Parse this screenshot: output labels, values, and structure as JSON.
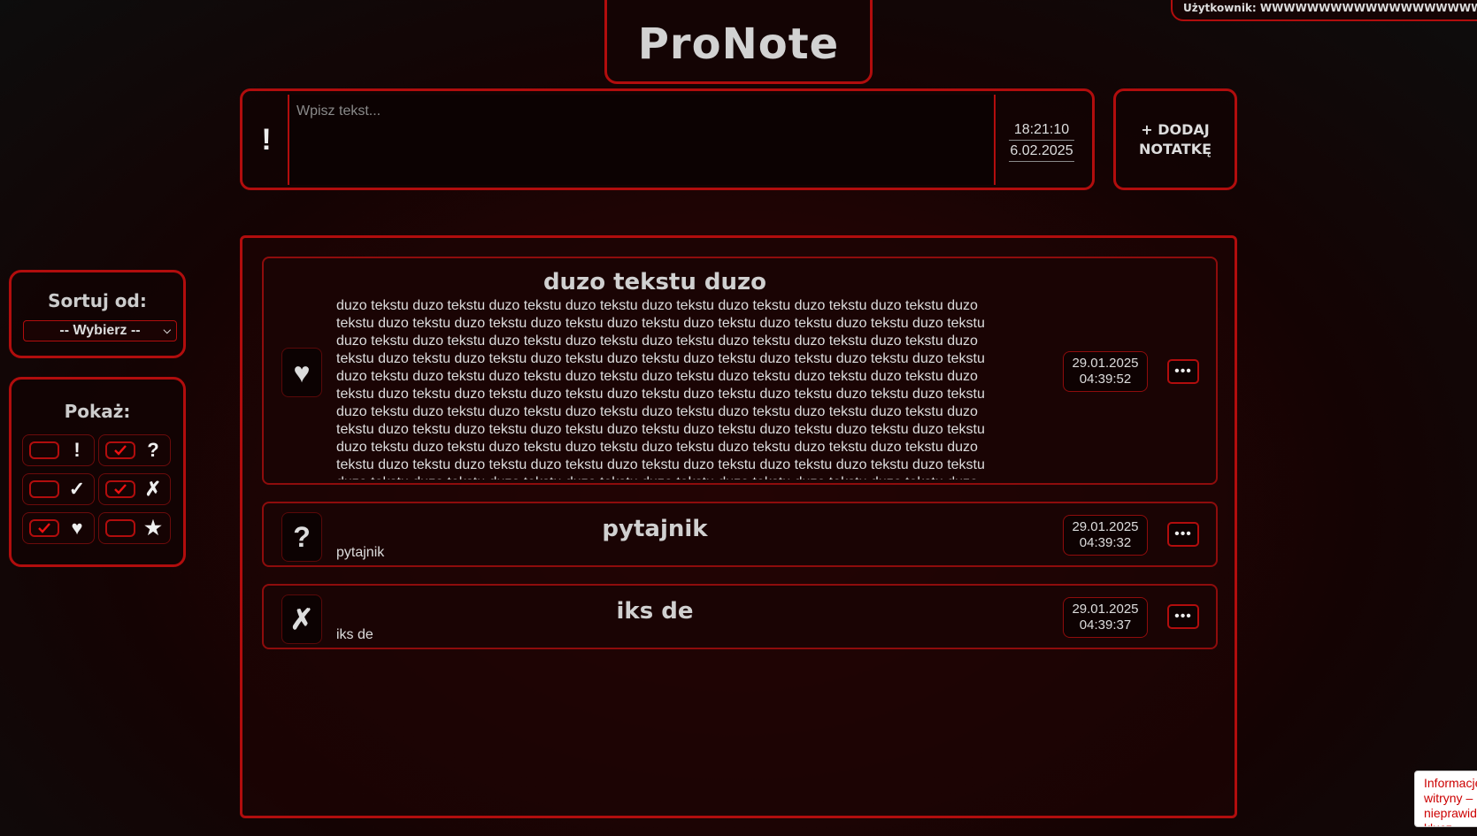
{
  "app": {
    "title": "ProNote",
    "user_label": "Użytkownik: WWWWWWWWWWWWWWWWWWWWWW"
  },
  "composer": {
    "priority_symbol": "!",
    "placeholder": "Wpisz tekst...",
    "time": "18:21:10",
    "date": "6.02.2025",
    "add_button": "+ DODAJ NOTATKĘ"
  },
  "sort": {
    "title": "Sortuj od:",
    "selected": "-- Wybierz --"
  },
  "filters": {
    "title": "Pokaż:",
    "items": [
      {
        "symbol": "!",
        "icon": "exclamation-icon",
        "checked": false
      },
      {
        "symbol": "?",
        "icon": "question-icon",
        "checked": true
      },
      {
        "symbol": "✓",
        "icon": "checkmark-icon",
        "checked": false
      },
      {
        "symbol": "✗",
        "icon": "cross-icon",
        "checked": true
      },
      {
        "symbol": "♥",
        "icon": "heart-icon",
        "checked": true
      },
      {
        "symbol": "★",
        "icon": "star-icon",
        "checked": false
      }
    ]
  },
  "notes": [
    {
      "icon": "heart-icon",
      "symbol": "♥",
      "title": "duzo tekstu duzo",
      "body": "duzo tekstu duzo tekstu duzo tekstu duzo tekstu duzo tekstu duzo tekstu duzo tekstu duzo tekstu duzo tekstu duzo tekstu duzo tekstu duzo tekstu duzo tekstu duzo tekstu duzo tekstu duzo tekstu duzo tekstu duzo tekstu duzo tekstu duzo tekstu duzo tekstu duzo tekstu duzo tekstu duzo tekstu duzo tekstu duzo tekstu duzo tekstu duzo tekstu duzo tekstu duzo tekstu duzo tekstu duzo tekstu duzo tekstu duzo tekstu duzo tekstu duzo tekstu duzo tekstu duzo tekstu duzo tekstu duzo tekstu duzo tekstu duzo tekstu duzo tekstu duzo tekstu duzo tekstu duzo tekstu duzo tekstu duzo tekstu duzo tekstu duzo tekstu duzo tekstu duzo tekstu duzo tekstu duzo tekstu duzo tekstu duzo tekstu duzo tekstu duzo tekstu duzo tekstu duzo tekstu duzo tekstu duzo tekstu duzo tekstu duzo tekstu duzo tekstu duzo tekstu duzo tekstu duzo tekstu duzo tekstu duzo tekstu duzo tekstu duzo tekstu duzo tekstu duzo tekstu duzo tekstu duzo tekstu duzo tekstu duzo tekstu duzo tekstu duzo tekstu duzo tekstu duzo tekstu duzo tekstu duzo tekstu duzo tekstu duzo tekstu duzo tekstu duzo tekstu duzo tekstu duzo tekstu duzo tekstu duzo tekstu duzo tekstu duzo tekstu duzo tekstu duzo tekstu duzo tekstu duzo tekstu duzo tekstu duzo tekstu duzo tekstu duzo tekstu",
      "date": "29.01.2025",
      "time": "04:39:52"
    },
    {
      "icon": "question-icon",
      "symbol": "?",
      "title": "pytajnik",
      "body": "pytajnik",
      "date": "29.01.2025",
      "time": "04:39:32"
    },
    {
      "icon": "cross-icon",
      "symbol": "✗",
      "title": "iks de",
      "body": "iks de",
      "date": "29.01.2025",
      "time": "04:39:37"
    }
  ],
  "toast": {
    "text": "Informacje witryny – nieprawidłowy klucz witryny"
  },
  "colors": {
    "accent": "#b10d0d",
    "bg": "#140303"
  }
}
